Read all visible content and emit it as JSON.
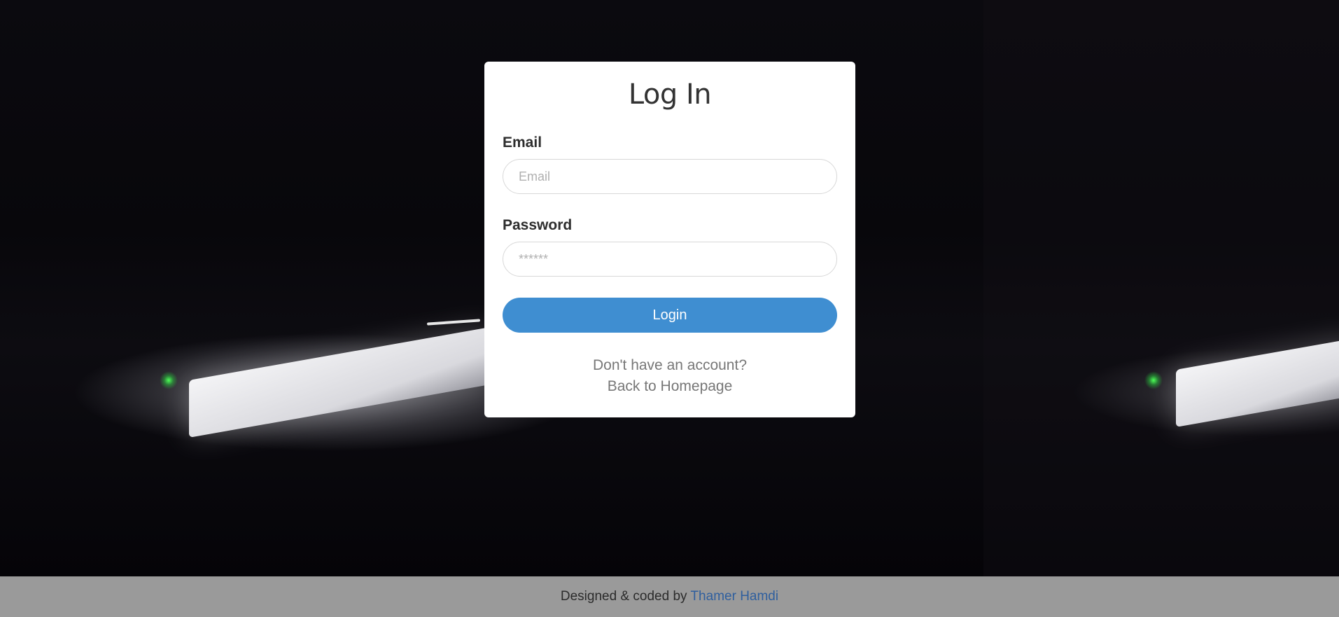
{
  "login_card": {
    "title": "Log In",
    "email": {
      "label": "Email",
      "placeholder": "Email",
      "value": ""
    },
    "password": {
      "label": "Password",
      "placeholder": "******",
      "value": ""
    },
    "submit_label": "Login",
    "signup_link": "Don't have an account?",
    "home_link": "Back to Homepage"
  },
  "footer": {
    "credit_prefix": "Designed & coded by",
    "author": "Thamer Hamdi"
  },
  "colors": {
    "accent": "#3f8ed1",
    "footer_bg": "#9a9a9a",
    "footer_link": "#2f5f9e"
  }
}
